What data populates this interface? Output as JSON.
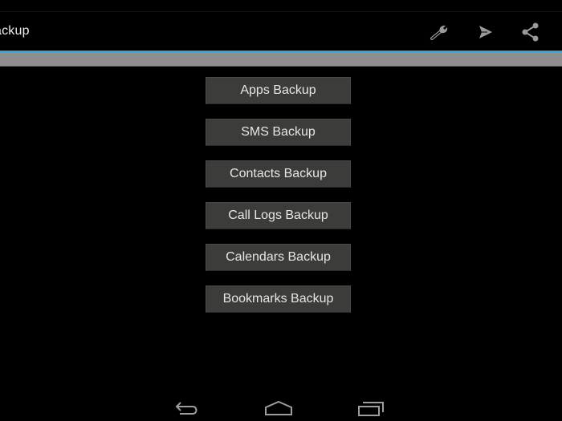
{
  "action_bar": {
    "title": "ackup",
    "icons": [
      {
        "name": "wrench-icon",
        "label": "Settings"
      },
      {
        "name": "send-icon",
        "label": "Send"
      },
      {
        "name": "share-icon",
        "label": "Share"
      }
    ]
  },
  "colors": {
    "accent": "#33a3d4",
    "background": "#000000",
    "button_bg": "#3c3d3a",
    "bar_gray": "#8e8e8e"
  },
  "buttons": [
    {
      "label": "Apps Backup"
    },
    {
      "label": "SMS Backup"
    },
    {
      "label": "Contacts Backup"
    },
    {
      "label": "Call Logs Backup"
    },
    {
      "label": "Calendars Backup"
    },
    {
      "label": "Bookmarks Backup"
    }
  ],
  "nav_bar": {
    "items": [
      {
        "name": "back-icon"
      },
      {
        "name": "home-icon"
      },
      {
        "name": "recent-apps-icon"
      }
    ]
  }
}
